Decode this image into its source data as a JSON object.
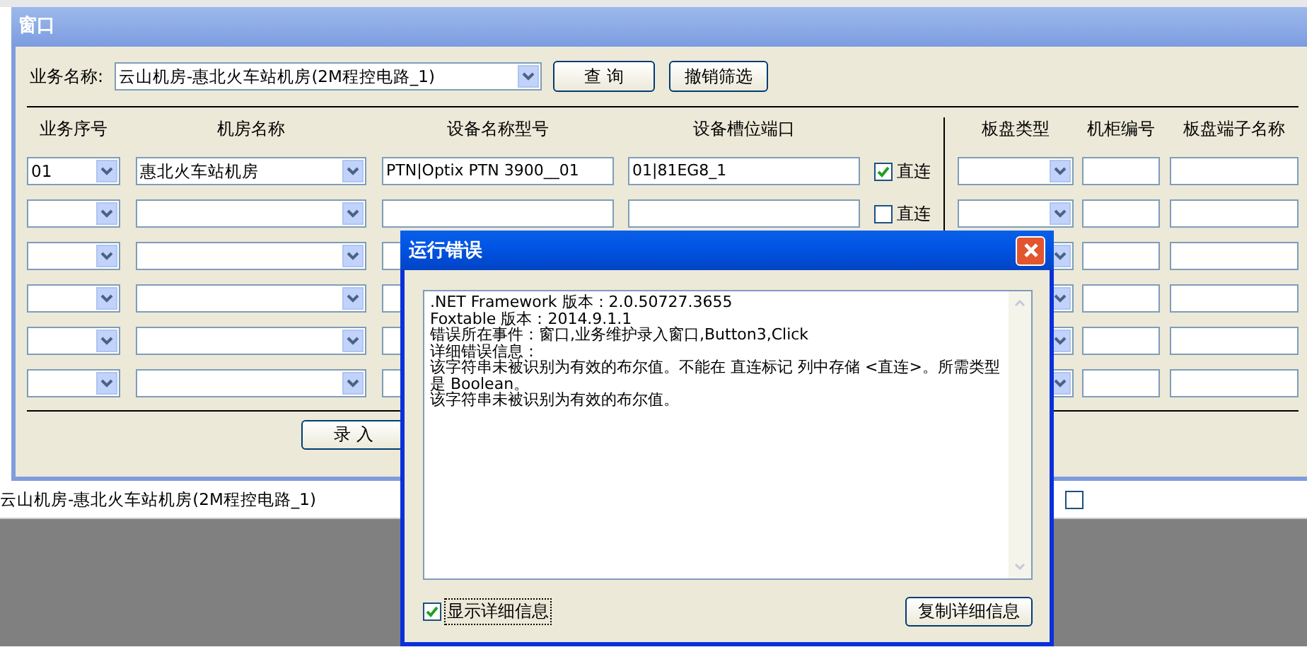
{
  "window": {
    "title": "窗口"
  },
  "filter": {
    "label": "业务名称:",
    "value": "云山机房-惠北火车站机房(2M程控电路_1)",
    "buttons": [
      "查 询",
      "撤销筛选"
    ]
  },
  "columns": [
    "业务序号",
    "机房名称",
    "设备名称型号",
    "设备槽位端口",
    "板盘类型",
    "机柜编号",
    "板盘端子名称"
  ],
  "rows": [
    {
      "seq": "01",
      "room": "惠北火车站机房",
      "device": "PTN|Optix PTN 3900__01",
      "slot": "01|81EG8_1",
      "direct": {
        "label": "直连",
        "checked": true
      }
    },
    {
      "direct": {
        "label": "直连",
        "checked": false
      }
    },
    {},
    {},
    {},
    {}
  ],
  "submit_button": "录 入",
  "background_row": {
    "text": "云山机房-惠北火车站机房(2M程控电路_1)",
    "checked": false
  },
  "dialog": {
    "title": "运行错误",
    "details": [
      ".NET Framework 版本：2.0.50727.3655",
      "Foxtable 版本：2014.9.1.1",
      "错误所在事件：窗口,业务维护录入窗口,Button3,Click",
      "详细错误信息：",
      "该字符串未被识别为有效的布尔值。不能在 直连标记 列中存储 <直连>。所需类型是 Boolean。",
      "该字符串未被识别为有效的布尔值。"
    ],
    "show_details": {
      "label": "显示详细信息",
      "checked": true
    },
    "copy_button": "复制详细信息"
  }
}
